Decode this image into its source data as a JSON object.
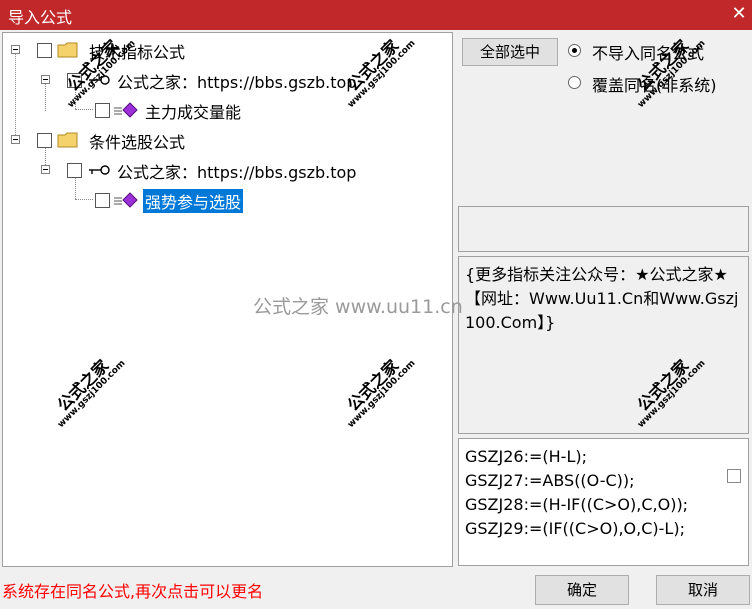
{
  "window": {
    "title": "导入公式",
    "close_glyph": "✕"
  },
  "tree": {
    "n1": {
      "label": "技术指标公式"
    },
    "n2": {
      "label": "公式之家：https://bbs.gszb.top"
    },
    "n3": {
      "label": "主力成交量能"
    },
    "n4": {
      "label": "条件选股公式"
    },
    "n5": {
      "label": "公式之家：https://bbs.gszb.top"
    },
    "n6": {
      "label": "强势参与选股"
    }
  },
  "controls": {
    "select_all": "全部选中",
    "radio_no_import": "不导入同名公式",
    "radio_overwrite": "覆盖同名(非系统)"
  },
  "description": "{更多指标关注公众号：★公式之家★【网址：Www.Uu11.Cn和Www.Gszj100.Com】}",
  "code_lines": [
    "GSZJ26:=(H-L);",
    "GSZJ27:=ABS((O-C));",
    "GSZJ28:=(H-IF((C>O),C,O));",
    "GSZJ29:=(IF((C>O),O,C)-L);"
  ],
  "status": {
    "text": "系统存在同名公式,再次点击可以更名",
    "color": "#ff0000"
  },
  "buttons": {
    "ok": "确定",
    "cancel": "取消"
  },
  "watermark": {
    "stamp_cn": "公式之家",
    "stamp_url": "www.gszj100.com",
    "center": "公式之家 www.uu11.cn"
  },
  "colors": {
    "titlebar": "#c0282a",
    "selection": "#0078d7",
    "folder": "#f5d26b",
    "gem": "#9b30d9"
  }
}
